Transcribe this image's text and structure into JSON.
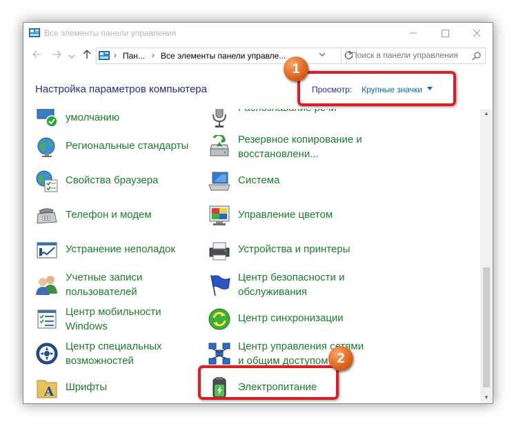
{
  "window": {
    "title": "Все элементы панели управления"
  },
  "address": {
    "crumb1": "Пан...",
    "crumb2": "Все элементы панели управле...",
    "search_placeholder": "Поиск в панели управления"
  },
  "header": {
    "title": "Настройка параметров компьютера",
    "view_label": "Просмотр:",
    "view_value": "Крупные значки"
  },
  "items_left": [
    {
      "line1": "",
      "line2": "умолчанию",
      "icon": "default-programs-icon"
    },
    {
      "line1": "Региональные стандарты",
      "line2": "",
      "icon": "region-globe-icon"
    },
    {
      "line1": "Свойства браузера",
      "line2": "",
      "icon": "internet-options-icon"
    },
    {
      "line1": "Телефон и модем",
      "line2": "",
      "icon": "phone-modem-icon"
    },
    {
      "line1": "Устранение неполадок",
      "line2": "",
      "icon": "troubleshooting-icon"
    },
    {
      "line1": "Учетные записи",
      "line2": "пользователей",
      "icon": "user-accounts-icon"
    },
    {
      "line1": "Центр мобильности",
      "line2": "Windows",
      "icon": "mobility-center-icon"
    },
    {
      "line1": "Центр специальных",
      "line2": "возможностей",
      "icon": "ease-of-access-icon"
    },
    {
      "line1": "Шрифты",
      "line2": "",
      "icon": "fonts-icon"
    }
  ],
  "items_right": [
    {
      "line1": "Распознавание речи",
      "line2": "",
      "icon": "speech-recognition-icon"
    },
    {
      "line1": "Резервное копирование и",
      "line2": "восстановлени...",
      "icon": "backup-restore-icon"
    },
    {
      "line1": "Система",
      "line2": "",
      "icon": "system-icon"
    },
    {
      "line1": "Управление цветом",
      "line2": "",
      "icon": "color-management-icon"
    },
    {
      "line1": "Устройства и принтеры",
      "line2": "",
      "icon": "devices-printers-icon"
    },
    {
      "line1": "Центр безопасности и",
      "line2": "обслуживания",
      "icon": "security-maintenance-icon"
    },
    {
      "line1": "Центр синхронизации",
      "line2": "",
      "icon": "sync-center-icon"
    },
    {
      "line1": "Центр управления сетями",
      "line2": "и общим доступом",
      "icon": "network-sharing-icon"
    },
    {
      "line1": "Электропитание",
      "line2": "",
      "icon": "power-options-icon"
    }
  ],
  "annotations": {
    "badge1": "1",
    "badge2": "2"
  },
  "colors": {
    "link": "#1a7d2b",
    "heading": "#1e3287",
    "accent": "#0066cc",
    "highlight": "#e01b24",
    "badge": "#e0661f"
  }
}
